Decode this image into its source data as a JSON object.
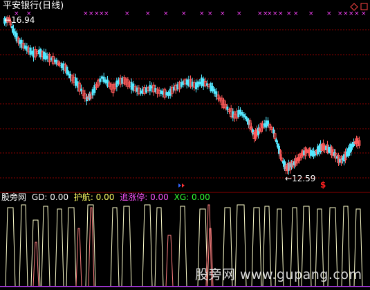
{
  "header": {
    "title": "平安银行(日线)",
    "title_color": "#ffffff"
  },
  "main_chart": {
    "high_label": "16.94",
    "low_label": "12.59",
    "signal_glyph": "$",
    "signal_color": "#ff2020",
    "marker_glyph": "×",
    "marker_color": "#ff44ff",
    "up_color": "#ff5a5a",
    "down_color": "#54e8ff",
    "grid_color": "#8b0000"
  },
  "indicator": {
    "source_label": "股旁网",
    "items": [
      {
        "name": "GD",
        "value": "0.00",
        "color": "#ffffff"
      },
      {
        "name": "护航",
        "value": "0.00",
        "color": "#ffff66"
      },
      {
        "name": "追涨停",
        "value": "0.00",
        "color": "#ff55ff"
      },
      {
        "name": "XG",
        "value": "0.00",
        "color": "#33ff33"
      }
    ],
    "line_color_1": "#ffffcc",
    "line_color_2": "#ff8080"
  },
  "watermark": "股旁网 www.gupang.com"
}
